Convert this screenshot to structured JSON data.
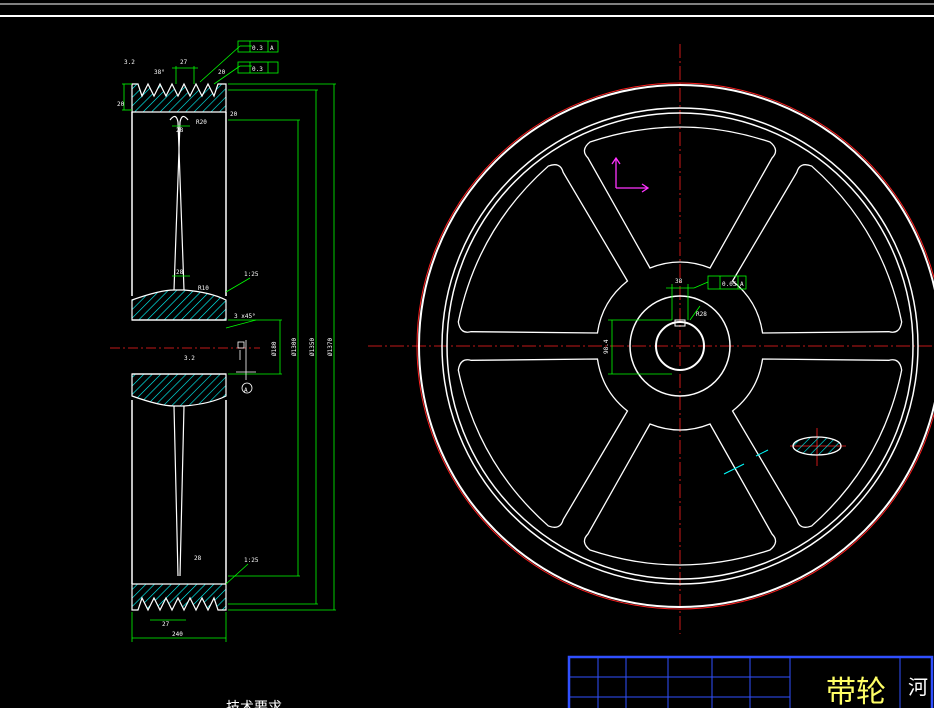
{
  "section": {
    "dims": {
      "fine_roughness": "3.2",
      "groove_angle": "38°",
      "groove_pitch": "27",
      "groove_edge": "20",
      "runout_top": "0.3",
      "runout_bottom": "0.3",
      "runout_ref": "A",
      "web_thickness": "28",
      "web_chamfer": "R20",
      "rim_edge": "20",
      "hub_chamfer": "1:25",
      "hub_radius": "R10",
      "keyway": "3.2",
      "bore_fit": "3 x45°",
      "dia_bore": "Ø180",
      "dia_hub": "Ø1300",
      "dia_rim": "Ø1350",
      "dia_outer": "Ø1370",
      "bottom_chamfer": "1:25",
      "bottom_pitch": "27",
      "bottom_width": "240",
      "datum_mark": "A",
      "hub_mark": "28"
    },
    "requirements_title": "技术要求"
  },
  "front": {
    "hub_callout": "38",
    "hub_tolerance": "0.05",
    "hub_ref": "A",
    "bore_dim": "98.4",
    "key_dim": "R28"
  },
  "title_block": {
    "title": "带轮",
    "org": "河"
  },
  "colors": {
    "geometry": "#ffffff",
    "dimension": "#00ff00",
    "centerline": "#ff2020",
    "hatch": "#00ffff",
    "ucs": "#ff33ff",
    "title_border": "#3050ff",
    "title_text": "#ffff66"
  },
  "icons": {
    "ucs": "ucs-axes-icon",
    "datum": "datum-triangle-icon"
  }
}
